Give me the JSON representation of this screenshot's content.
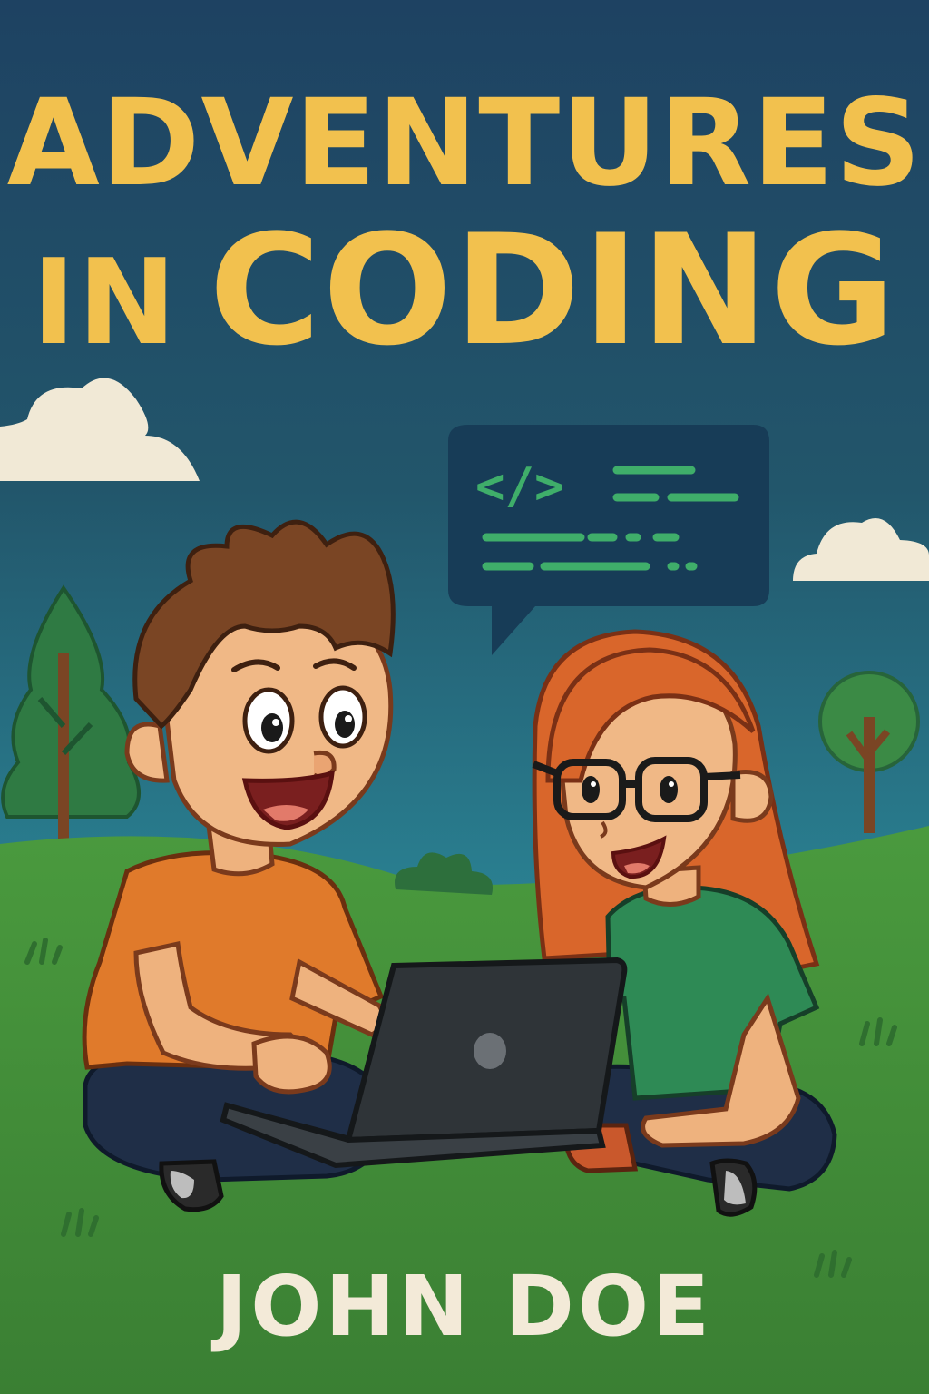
{
  "cover": {
    "title_line_1": "ADVENTURES",
    "title_line_2_small": "IN",
    "title_line_2_large": "CODING",
    "author": "JOHN DOE"
  },
  "speech_bubble": {
    "code_tag": "</>"
  },
  "colors": {
    "sky_top": "#1f4763",
    "sky_bottom": "#2a8a96",
    "grass": "#3f8a3a",
    "title": "#f2c14e",
    "author": "#f3ead8",
    "bubble": "#173c57",
    "code_green": "#3fae6a",
    "boy_shirt": "#e07a2b",
    "girl_shirt": "#2e8a55",
    "girl_hair": "#d9662b",
    "boy_hair": "#7a4524",
    "laptop": "#2f3438"
  },
  "icons": [
    "cloud-icon",
    "tree-icon",
    "speech-bubble-icon",
    "laptop-icon",
    "glasses-icon"
  ]
}
